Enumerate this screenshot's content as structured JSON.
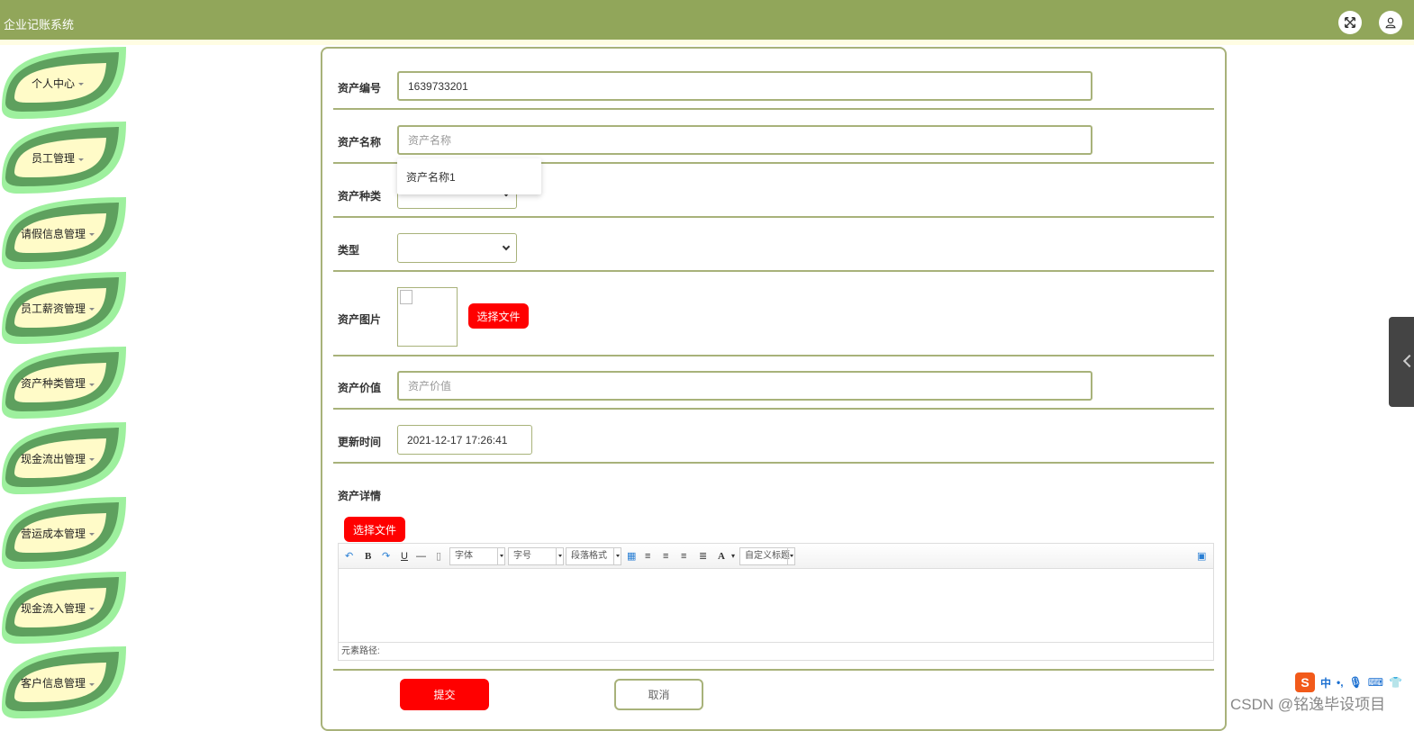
{
  "header": {
    "app_title": "企业记账系统",
    "fullscreen_icon": "expand-icon",
    "user_icon": "user-icon"
  },
  "sidebar": {
    "items": [
      {
        "label": "个人中心"
      },
      {
        "label": "员工管理"
      },
      {
        "label": "请假信息管理"
      },
      {
        "label": "员工薪资管理"
      },
      {
        "label": "资产种类管理"
      },
      {
        "label": "现金流出管理"
      },
      {
        "label": "营运成本管理"
      },
      {
        "label": "现金流入管理"
      },
      {
        "label": "客户信息管理"
      }
    ]
  },
  "form": {
    "asset_no_label": "资产编号",
    "asset_no_value": "1639733201",
    "asset_name_label": "资产名称",
    "asset_name_placeholder": "资产名称",
    "asset_name_suggestion": "资产名称1",
    "asset_category_label": "资产种类",
    "type_label": "类型",
    "asset_image_label": "资产图片",
    "choose_file_label": "选择文件",
    "asset_value_label": "资产价值",
    "asset_value_placeholder": "资产价值",
    "update_time_label": "更新时间",
    "update_time_value": "2021-12-17 17:26:41",
    "asset_detail_label": "资产详情",
    "detail_choose_file_label": "选择文件",
    "submit_label": "提交",
    "cancel_label": "取消"
  },
  "editor": {
    "font_family": "字体",
    "font_size": "字号",
    "paragraph": "段落格式",
    "custom_title": "自定义标题",
    "bold": "B",
    "underline": "U",
    "font_color": "A",
    "footer_path": "元素路径:"
  },
  "system": {
    "ime_logo": "S",
    "ime_mode": "中",
    "ime_punct": "•,",
    "watermark": "CSDN @铭逸毕设项目"
  },
  "colors": {
    "header_bg": "#91a65a",
    "border": "#a8b27a",
    "accent_red": "#ff0000",
    "leaf_dark": "#5ea05e",
    "leaf_light": "#9ef09e",
    "leaf_inner": "#fffbc8"
  }
}
